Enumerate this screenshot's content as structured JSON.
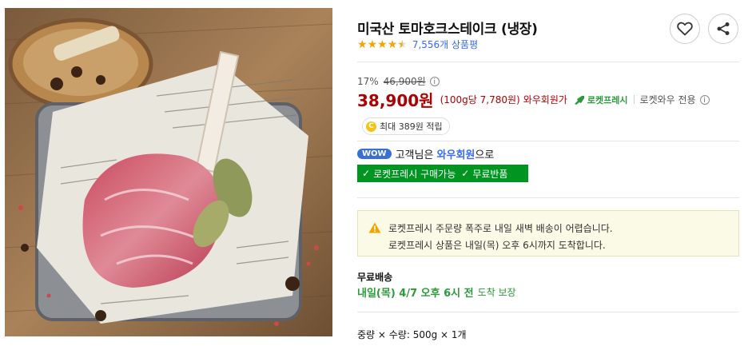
{
  "product": {
    "title": "미국산 토마호크스테이크 (냉장)",
    "rating": 4.5,
    "review_count": "7,556개 상품평"
  },
  "price": {
    "discount_rate": "17%",
    "original_price": "46,900원",
    "sale_price": "38,900원",
    "unit_price": "(100g당 7,780원)",
    "member_label": "와우회원가",
    "rocket_label": "로켓프레시",
    "only_label": "로켓와우 전용"
  },
  "cashback": {
    "coin_symbol": "C",
    "label": "최대 389원 적립"
  },
  "wow": {
    "badge": "WOW",
    "prefix": "고객님은",
    "member": "와우회원",
    "suffix": "으로"
  },
  "benefits": [
    "로켓프레시 구매가능",
    "무료반품"
  ],
  "notice": {
    "line1": "로켓프레시 주문량 폭주로 내일 새벽 배송이 어렵습니다.",
    "line2": "로켓프레시 상품은 내일(목) 오후 6시까지 도착합니다."
  },
  "shipping": {
    "label": "무료배송",
    "date": "내일(목) 4/7 오후 6시 전",
    "note": "도착 보장"
  },
  "option": {
    "text": "중량 × 수량: 500g × 1개"
  },
  "colors": {
    "price_red": "#ae0000",
    "rocket_green": "#2c9a3b",
    "star_orange": "#f7a400",
    "link_blue": "#346aff"
  },
  "icons": [
    "heart-icon",
    "share-icon",
    "star-icon",
    "info-icon",
    "rocket-icon",
    "coin-icon",
    "check-icon",
    "warning-icon"
  ]
}
